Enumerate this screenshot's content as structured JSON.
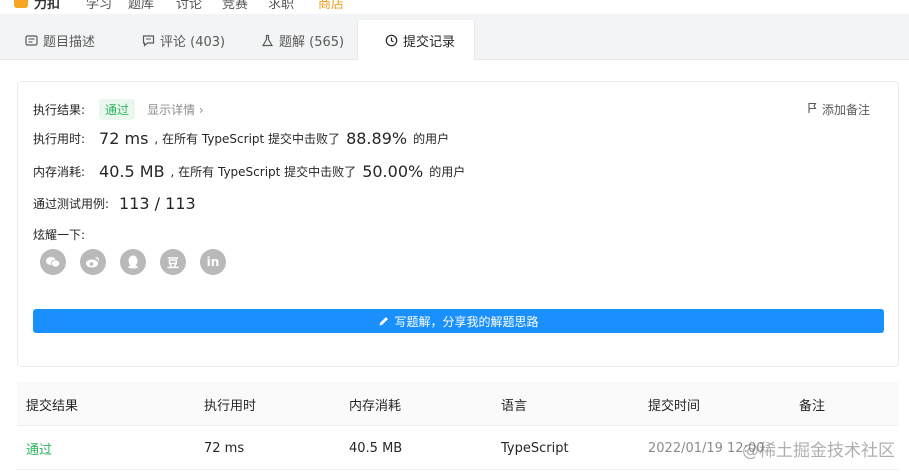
{
  "topnav": {
    "brand": "力扣",
    "items": [
      "学习",
      "题库",
      "讨论",
      "竞赛",
      "求职",
      "商店"
    ]
  },
  "tabs": [
    {
      "label": "题目描述",
      "icon": "description-icon"
    },
    {
      "label": "评论 (403)",
      "icon": "comment-icon"
    },
    {
      "label": "题解 (565)",
      "icon": "flask-icon"
    },
    {
      "label": "提交记录",
      "icon": "clock-icon",
      "active": true
    }
  ],
  "result": {
    "status_label": "执行结果:",
    "status_value": "通过",
    "detail_link": "显示详情 ›",
    "add_note": "添加备注",
    "runtime_label": "执行用时:",
    "runtime_value": "72 ms",
    "runtime_text": ", 在所有 TypeScript 提交中击败了",
    "runtime_percent": "88.89%",
    "runtime_suffix": "的用户",
    "memory_label": "内存消耗:",
    "memory_value": "40.5 MB",
    "memory_text": ", 在所有 TypeScript 提交中击败了",
    "memory_percent": "50.00%",
    "memory_suffix": "的用户",
    "tests_label": "通过测试用例:",
    "tests_value": "113 / 113",
    "share_label": "炫耀一下:",
    "share_icons": [
      "wechat-icon",
      "weibo-icon",
      "qq-icon",
      "douban-icon",
      "linkedin-icon"
    ],
    "douban_glyph": "豆",
    "linkedin_glyph": "in",
    "write_button": "写题解，分享我的解题思路"
  },
  "table": {
    "headers": [
      "提交结果",
      "执行用时",
      "内存消耗",
      "语言",
      "提交时间",
      "备注"
    ],
    "rows": [
      [
        "通过",
        "72 ms",
        "40.5 MB",
        "TypeScript",
        "2022/01/19 12:00",
        ""
      ]
    ]
  },
  "watermark": "@稀土掘金技术社区",
  "colors": {
    "accent": "#1a90ff",
    "success": "#2db55d"
  }
}
